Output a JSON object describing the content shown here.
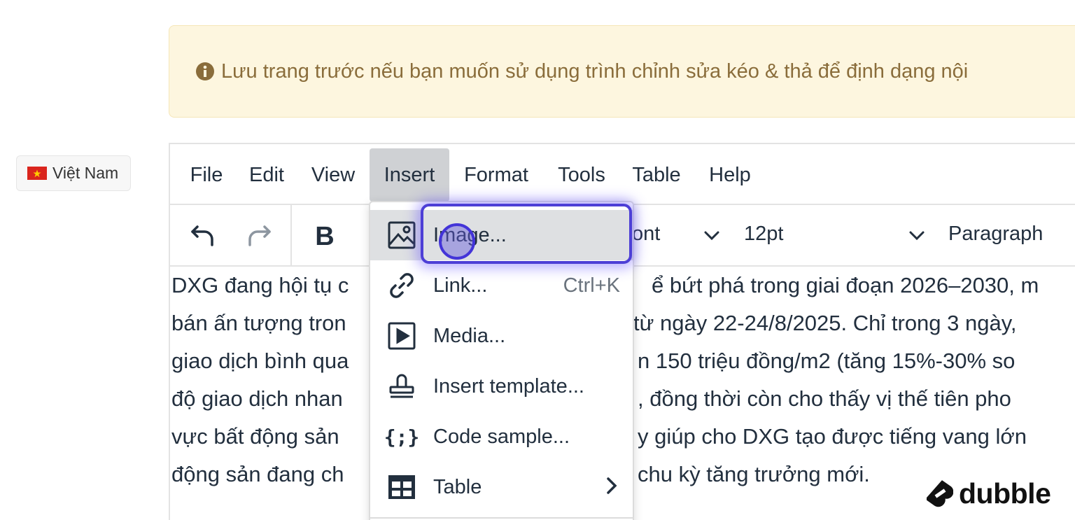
{
  "alert": {
    "text": "Lưu trang trước nếu bạn muốn sử dụng trình chỉnh sửa kéo & thả để định dạng nội"
  },
  "language": {
    "label": "Việt Nam"
  },
  "menubar": {
    "items": [
      {
        "label": "File"
      },
      {
        "label": "Edit"
      },
      {
        "label": "View"
      },
      {
        "label": "Insert",
        "active": true
      },
      {
        "label": "Format"
      },
      {
        "label": "Tools"
      },
      {
        "label": "Table"
      },
      {
        "label": "Help"
      }
    ]
  },
  "toolbar": {
    "bold_label": "B",
    "font_partial": "ont",
    "font_size": "12pt",
    "block_format": "Paragraph"
  },
  "content": {
    "lines": [
      {
        "left": "DXG đang hội tụ c",
        "right": "ể bứt phá trong giai đoạn 2026–2030, m"
      },
      {
        "left": "bán ấn tượng tron",
        "right": "từ ngày 22-24/8/2025. Chỉ trong 3 ngày,"
      },
      {
        "left": "giao dịch bình qua",
        "right": "n 150 triệu đồng/m2 (tăng 15%-30% so"
      },
      {
        "left": "độ giao dịch nhan",
        "right": ", đồng thời còn cho thấy vị thế tiên pho"
      },
      {
        "left": "vực bất động sản",
        "right": "y giúp cho DXG tạo được tiếng vang lớn"
      },
      {
        "left": "động sản đang ch",
        "right": "chu kỳ tăng trưởng mới."
      }
    ]
  },
  "insert_menu": {
    "items": [
      {
        "label": "Image...",
        "icon": "image-icon"
      },
      {
        "label": "Link...",
        "icon": "link-icon",
        "shortcut": "Ctrl+K"
      },
      {
        "label": "Media...",
        "icon": "media-icon"
      },
      {
        "label": "Insert template...",
        "icon": "template-icon"
      },
      {
        "label": "Code sample...",
        "icon": "code-sample-icon"
      },
      {
        "label": "Table",
        "icon": "table-icon",
        "submenu": true
      }
    ]
  },
  "watermark": {
    "text": "dubble"
  },
  "colors": {
    "alert_bg": "#fdf6df",
    "alert_text": "#8a6d3b",
    "highlight_ring": "#4d3fd6",
    "menu_active_bg": "#cfd1d4"
  }
}
